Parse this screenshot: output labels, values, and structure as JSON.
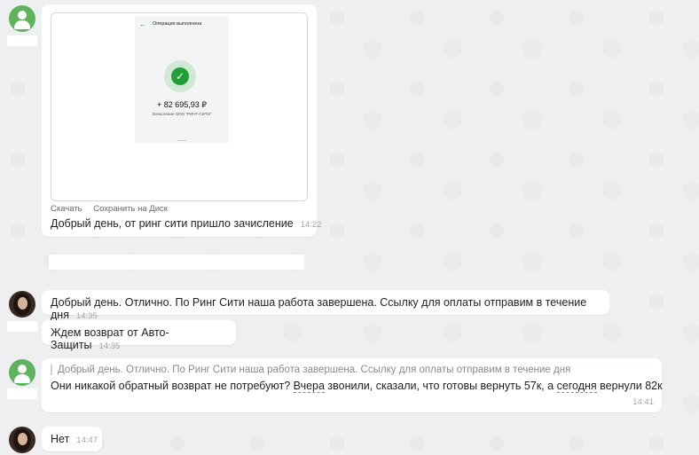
{
  "receipt": {
    "title": "Операция выполнена",
    "amount": "+ 82 695,93 ₽",
    "subtitle": "Зачисление ООО \"РИНГ-СИТИ\""
  },
  "media_actions": {
    "download": "Скачать",
    "save_to_disk": "Сохранить на Диск"
  },
  "messages": [
    {
      "text": "Добрый день, от ринг сити пришло зачисление",
      "time": "14:22"
    },
    {
      "text": "Добрый день. Отлично. По Ринг Сити наша работа завершена. Ссылку для оплаты отправим в течение дня",
      "time": "14:35"
    },
    {
      "text": "Ждем возврат от Авто-Защиты",
      "time": "14:35"
    },
    {
      "quote": "Добрый день. Отлично. По Ринг Сити наша работа завершена. Ссылку для оплаты отправим в течение дня",
      "text_1": "Они никакой обратный возврат не потребуют? ",
      "word_1": "Вчера",
      "text_2": " звонили, сказали, что готовы вернуть 57к, а ",
      "word_2": "сегодня",
      "text_3": " вернули 82к",
      "time": "14:41"
    },
    {
      "text": "Нет",
      "time": "14:47"
    }
  ],
  "colors": {
    "accent_green": "#21a038",
    "avatar_green": "#5fb35f",
    "background": "#eeeff1"
  }
}
